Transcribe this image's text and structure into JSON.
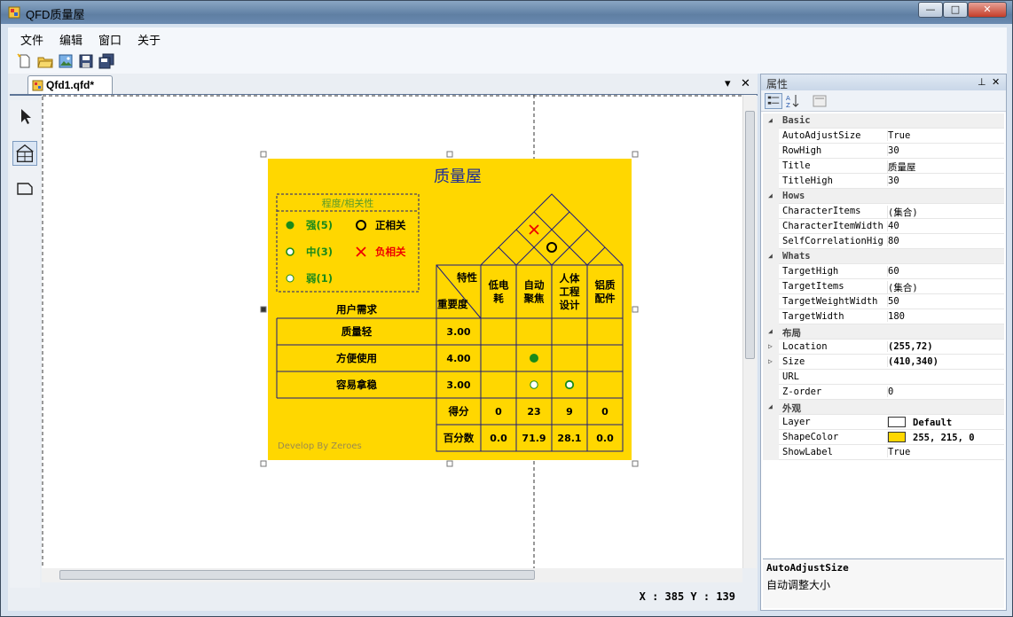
{
  "window": {
    "title": "QFD质量屋",
    "minimize": "—",
    "maximize": "□",
    "close": "✕"
  },
  "menu": {
    "items": [
      "文件",
      "编辑",
      "窗口",
      "关于"
    ]
  },
  "toolbar": {
    "icons": [
      "new-icon",
      "open-icon",
      "image-icon",
      "save-icon",
      "save-all-icon"
    ]
  },
  "document": {
    "tab_label": "Qfd1.qfd*",
    "dropdown": "▾",
    "close": "✕"
  },
  "tools": [
    "pointer-tool-icon",
    "house-tool-icon",
    "shape-tool-icon"
  ],
  "qfd": {
    "title": "质量屋",
    "fill_color": "#ffd700",
    "legend": {
      "title": "程度/相关性",
      "strong": "强(5)",
      "medium": "中(3)",
      "weak": "弱(1)",
      "positive": "正相关",
      "negative": "负相关"
    },
    "header_characteristic": "特性",
    "header_importance": "重要度",
    "header_needs": "用户需求",
    "characteristics": [
      {
        "lines": [
          "低电",
          "耗"
        ]
      },
      {
        "lines": [
          "自动",
          "聚焦"
        ]
      },
      {
        "lines": [
          "人体",
          "工程",
          "设计"
        ]
      },
      {
        "lines": [
          "铝质",
          "配件"
        ]
      }
    ],
    "requirements": [
      {
        "name": "质量轻",
        "weight": "3.00",
        "marks": [
          "",
          "",
          "",
          ""
        ]
      },
      {
        "name": "方便使用",
        "weight": "4.00",
        "marks": [
          "",
          "strong",
          "",
          ""
        ]
      },
      {
        "name": "容易拿稳",
        "weight": "3.00",
        "marks": [
          "",
          "weak",
          "medium",
          ""
        ]
      }
    ],
    "score_label": "得分",
    "scores": [
      "0",
      "23",
      "9",
      "0"
    ],
    "percent_label": "百分数",
    "percents": [
      "0.0",
      "71.9",
      "28.1",
      "0.0"
    ],
    "watermark": "Develop By Zeroes",
    "roof": [
      {
        "between": [
          1,
          3
        ],
        "type": "negative"
      },
      {
        "between": [
          2,
          4
        ],
        "type": "positive"
      }
    ]
  },
  "status": {
    "coords": "X : 385 Y : 139"
  },
  "properties": {
    "panel_title": "属性",
    "pin": "⊥",
    "close": "✕",
    "rows": [
      {
        "cat": true,
        "name": "Basic"
      },
      {
        "name": "AutoAdjustSize",
        "value": "True"
      },
      {
        "name": "RowHigh",
        "value": "30"
      },
      {
        "name": "Title",
        "value": "质量屋"
      },
      {
        "name": "TitleHigh",
        "value": "30"
      },
      {
        "cat": true,
        "name": "Hows"
      },
      {
        "name": "CharacterItems",
        "value": "(集合)"
      },
      {
        "name": "CharacterItemWidth",
        "value": "40"
      },
      {
        "name": "SelfCorrelationHigh",
        "value": "80"
      },
      {
        "cat": true,
        "name": "Whats"
      },
      {
        "name": "TargetHigh",
        "value": "60"
      },
      {
        "name": "TargetItems",
        "value": "(集合)"
      },
      {
        "name": "TargetWeightWidth",
        "value": "50"
      },
      {
        "name": "TargetWidth",
        "value": "180"
      },
      {
        "cat": true,
        "name": "布局"
      },
      {
        "name": "Location",
        "value": "(255,72)",
        "expand": true
      },
      {
        "name": "Size",
        "value": "(410,340)",
        "expand": true
      },
      {
        "name": "URL",
        "value": ""
      },
      {
        "name": "Z-order",
        "value": "0"
      },
      {
        "cat": true,
        "name": "外观"
      },
      {
        "name": "Layer",
        "value": "Default",
        "swatch": "#ffffff"
      },
      {
        "name": "ShapeColor",
        "value": "255, 215, 0",
        "swatch": "#ffd700"
      },
      {
        "name": "ShowLabel",
        "value": "True"
      }
    ],
    "desc_title": "AutoAdjustSize",
    "desc_text": "自动调整大小"
  }
}
